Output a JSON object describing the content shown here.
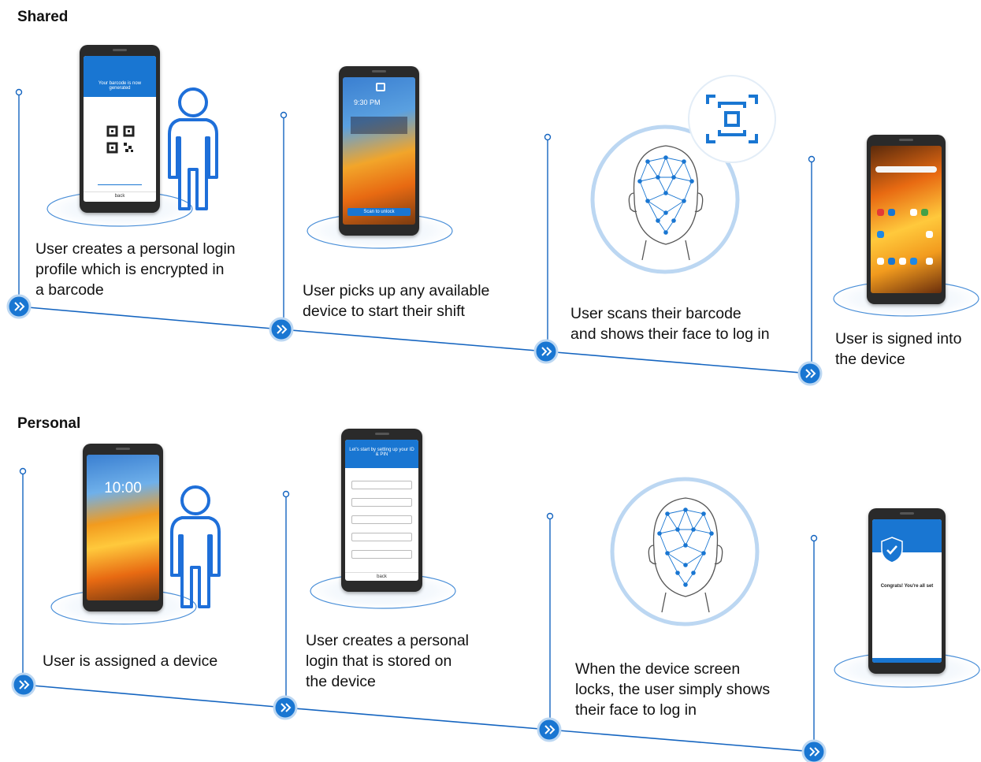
{
  "sections": {
    "shared": {
      "title": "Shared",
      "steps": [
        {
          "caption": "User creates a personal login\nprofile which is encrypted in\na barcode"
        },
        {
          "caption": "User picks up any available\ndevice to start their shift"
        },
        {
          "caption": "User scans their barcode\nand shows their face to log in"
        },
        {
          "caption": "User is signed into\nthe device"
        }
      ]
    },
    "personal": {
      "title": "Personal",
      "steps": [
        {
          "caption": "User is assigned a device"
        },
        {
          "caption": "User creates a personal\nlogin that is stored on\nthe device"
        },
        {
          "caption": "When the device screen\nlocks, the user simply shows\ntheir face to log in"
        },
        {
          "caption": ""
        }
      ]
    }
  },
  "phone_screens": {
    "barcode_header": "Your barcode is now generated",
    "barcode_button": "back",
    "lock_time": "9:30 PM",
    "lock_button": "Scan to unlock",
    "home_time": "10:00",
    "setup_header": "Let's start by setting up your ID & PIN",
    "setup_button": "back",
    "success_text": "Congrats! You're all set"
  },
  "colors": {
    "accent": "#1976d2",
    "line": "#1565c0",
    "ring": "#bcd7f2",
    "figure": "#1e6fd9"
  }
}
